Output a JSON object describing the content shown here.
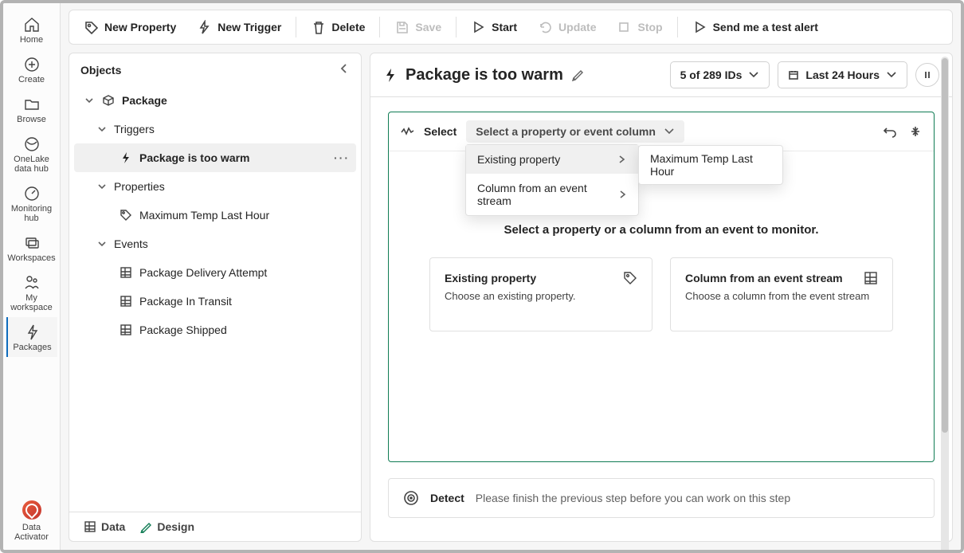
{
  "leftrail": {
    "items": [
      {
        "label": "Home"
      },
      {
        "label": "Create"
      },
      {
        "label": "Browse"
      },
      {
        "label": "OneLake data hub"
      },
      {
        "label": "Monitoring hub"
      },
      {
        "label": "Workspaces"
      },
      {
        "label": "My workspace"
      },
      {
        "label": "Packages"
      }
    ],
    "bottom": {
      "label": "Data Activator"
    }
  },
  "toolbar": {
    "new_property": "New Property",
    "new_trigger": "New Trigger",
    "delete": "Delete",
    "save": "Save",
    "start": "Start",
    "update": "Update",
    "stop": "Stop",
    "send_test": "Send me a test alert"
  },
  "objects_panel": {
    "header": "Objects",
    "tree": {
      "package": "Package",
      "triggers_section": "Triggers",
      "trigger_item": "Package is too warm",
      "properties_section": "Properties",
      "property_item": "Maximum Temp Last Hour",
      "events_section": "Events",
      "events": [
        "Package Delivery Attempt",
        "Package In Transit",
        "Package Shipped"
      ]
    },
    "footer": {
      "data": "Data",
      "design": "Design"
    }
  },
  "right": {
    "title": "Package is too warm",
    "ids_label": "5 of 289 IDs",
    "time_label": "Last 24 Hours"
  },
  "step": {
    "select_label": "Select",
    "dropdown_placeholder": "Select a property or event column",
    "flyout": {
      "existing": "Existing property",
      "column": "Column from an event stream",
      "sub_item": "Maximum Temp Last Hour"
    },
    "hint": "Select a property or a column from an event to monitor.",
    "choices": {
      "c1_title": "Existing property",
      "c1_desc": "Choose an existing property.",
      "c2_title": "Column from an event stream",
      "c2_desc": "Choose a column from the event stream"
    }
  },
  "detect": {
    "label": "Detect",
    "message": "Please finish the previous step before you can work on this step"
  }
}
